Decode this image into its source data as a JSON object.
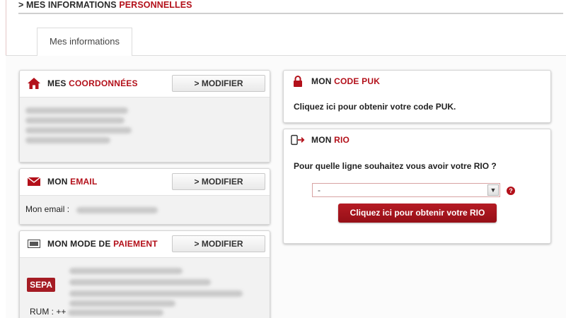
{
  "header": {
    "prefix": "> MES INFORMATIONS",
    "highlight": "PERSONNELLES"
  },
  "tabs": [
    {
      "label": "Mes informations"
    }
  ],
  "coordonnees": {
    "title_prefix": "MES",
    "title_highlight": "COORDONNÉES",
    "modify_label": "> MODIFIER",
    "icon": "home-icon"
  },
  "email": {
    "title_prefix": "MON",
    "title_highlight": "EMAIL",
    "modify_label": "> MODIFIER",
    "label": "Mon email :",
    "icon": "envelope-icon"
  },
  "paiement": {
    "title_prefix": "MON MODE DE",
    "title_highlight": "PAIEMENT",
    "modify_label": "> MODIFIER",
    "badge": "SEPA",
    "rum_label": "RUM : ++",
    "icon": "card-icon"
  },
  "puk": {
    "title_prefix": "MON",
    "title_highlight": "CODE PUK",
    "text": "Cliquez ici pour obtenir votre code PUK.",
    "icon": "lock-icon"
  },
  "rio": {
    "title_prefix": "MON",
    "title_highlight": "RIO",
    "question": "Pour quelle ligne souhaitez vous avoir votre RIO ?",
    "select_value": "-",
    "button_label": "Cliquez ici pour obtenir votre RIO",
    "help": "?",
    "icon": "phone-exit-icon"
  },
  "colors": {
    "brand_red": "#b3101a",
    "button_red": "#a51c24"
  }
}
